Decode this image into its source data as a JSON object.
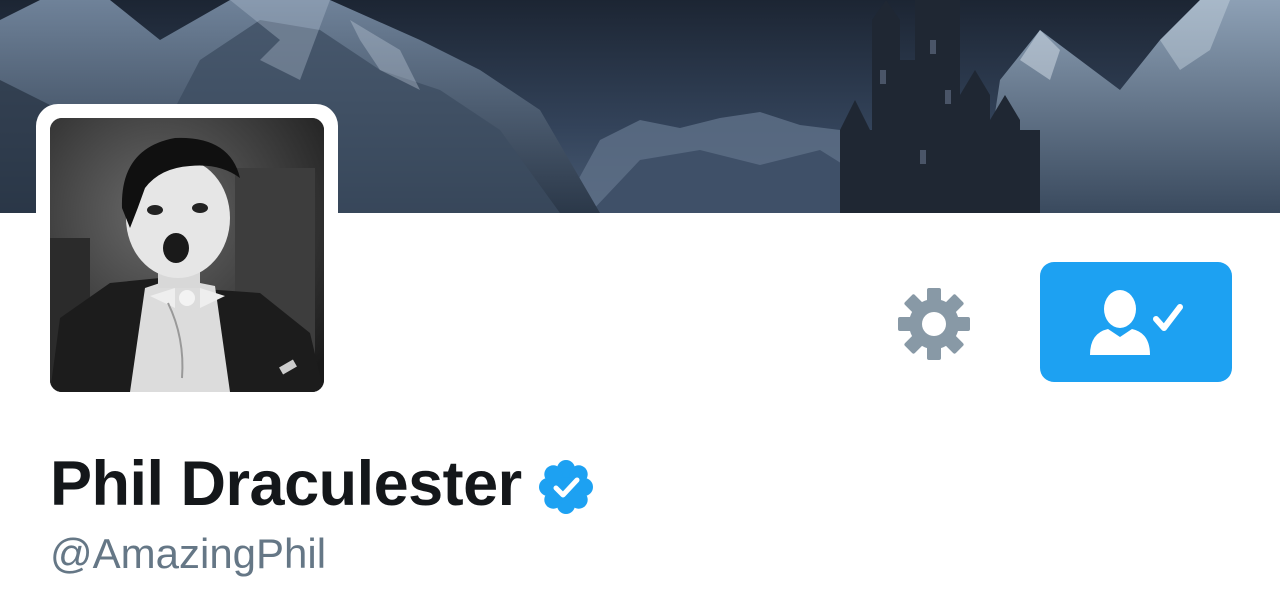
{
  "profile": {
    "display_name": "Phil Draculester",
    "handle": "@AmazingPhil",
    "verified": true
  },
  "header": {
    "banner_description": "dark castle among snowy mountains"
  },
  "actions": {
    "settings_icon": "gear-icon",
    "following_icon": "person-check-icon"
  },
  "colors": {
    "accent": "#1da1f2",
    "name_text": "#14171a",
    "handle_text": "#657786",
    "gear": "#8899a6",
    "verified": "#1da1f2"
  }
}
